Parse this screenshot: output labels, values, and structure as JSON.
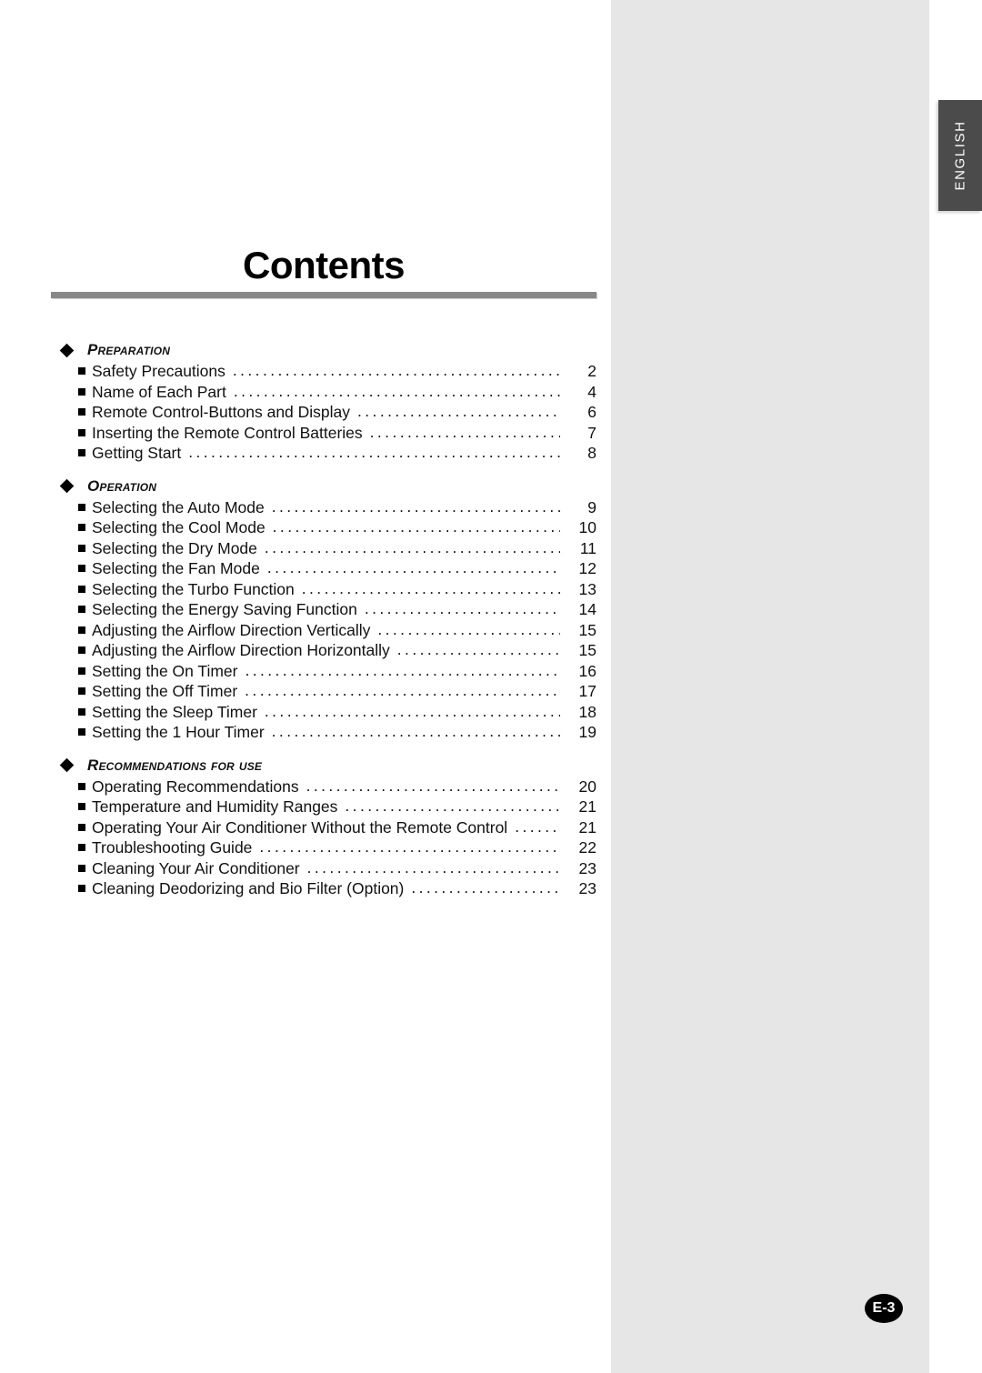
{
  "document": {
    "title": "Contents",
    "language_tab": "ENGLISH",
    "page_label": "E-3"
  },
  "icons": {
    "section_bullet": "diamond-bullet-icon",
    "item_bullet": "square-bullet-icon"
  },
  "colors": {
    "page_white": "#ffffff",
    "page_gray": "#e6e6e6",
    "rule_gray": "#888888",
    "tab_dark": "#4b4b4b",
    "text_black": "#111111"
  },
  "toc": {
    "sections": [
      {
        "heading": "Preparation",
        "items": [
          {
            "label": "Safety Precautions",
            "page": "2"
          },
          {
            "label": "Name of Each Part",
            "page": "4"
          },
          {
            "label": "Remote Control-Buttons and Display",
            "page": "6"
          },
          {
            "label": "Inserting the Remote Control Batteries",
            "page": "7"
          },
          {
            "label": "Getting Start",
            "page": "8"
          }
        ]
      },
      {
        "heading": "Operation",
        "items": [
          {
            "label": "Selecting the Auto Mode",
            "page": "9"
          },
          {
            "label": "Selecting the Cool Mode",
            "page": "10"
          },
          {
            "label": "Selecting the Dry Mode",
            "page": "11"
          },
          {
            "label": "Selecting the Fan Mode",
            "page": "12"
          },
          {
            "label": "Selecting the Turbo Function",
            "page": "13"
          },
          {
            "label": "Selecting the Energy Saving Function",
            "page": "14"
          },
          {
            "label": "Adjusting the Airflow Direction Vertically",
            "page": "15"
          },
          {
            "label": "Adjusting the Airflow Direction Horizontally",
            "page": "15"
          },
          {
            "label": "Setting the On Timer",
            "page": "16"
          },
          {
            "label": "Setting the Off Timer",
            "page": "17"
          },
          {
            "label": "Setting the Sleep Timer",
            "page": "18"
          },
          {
            "label": "Setting the 1 Hour Timer",
            "page": "19"
          }
        ]
      },
      {
        "heading": "Recommendations for use",
        "items": [
          {
            "label": "Operating Recommendations",
            "page": "20"
          },
          {
            "label": "Temperature and Humidity Ranges",
            "page": "21"
          },
          {
            "label": "Operating Your Air Conditioner Without the Remote Control",
            "page": "21"
          },
          {
            "label": "Troubleshooting Guide",
            "page": "22"
          },
          {
            "label": "Cleaning Your Air Conditioner",
            "page": "23"
          },
          {
            "label": "Cleaning Deodorizing and Bio Filter (Option)",
            "page": "23"
          }
        ]
      }
    ]
  }
}
